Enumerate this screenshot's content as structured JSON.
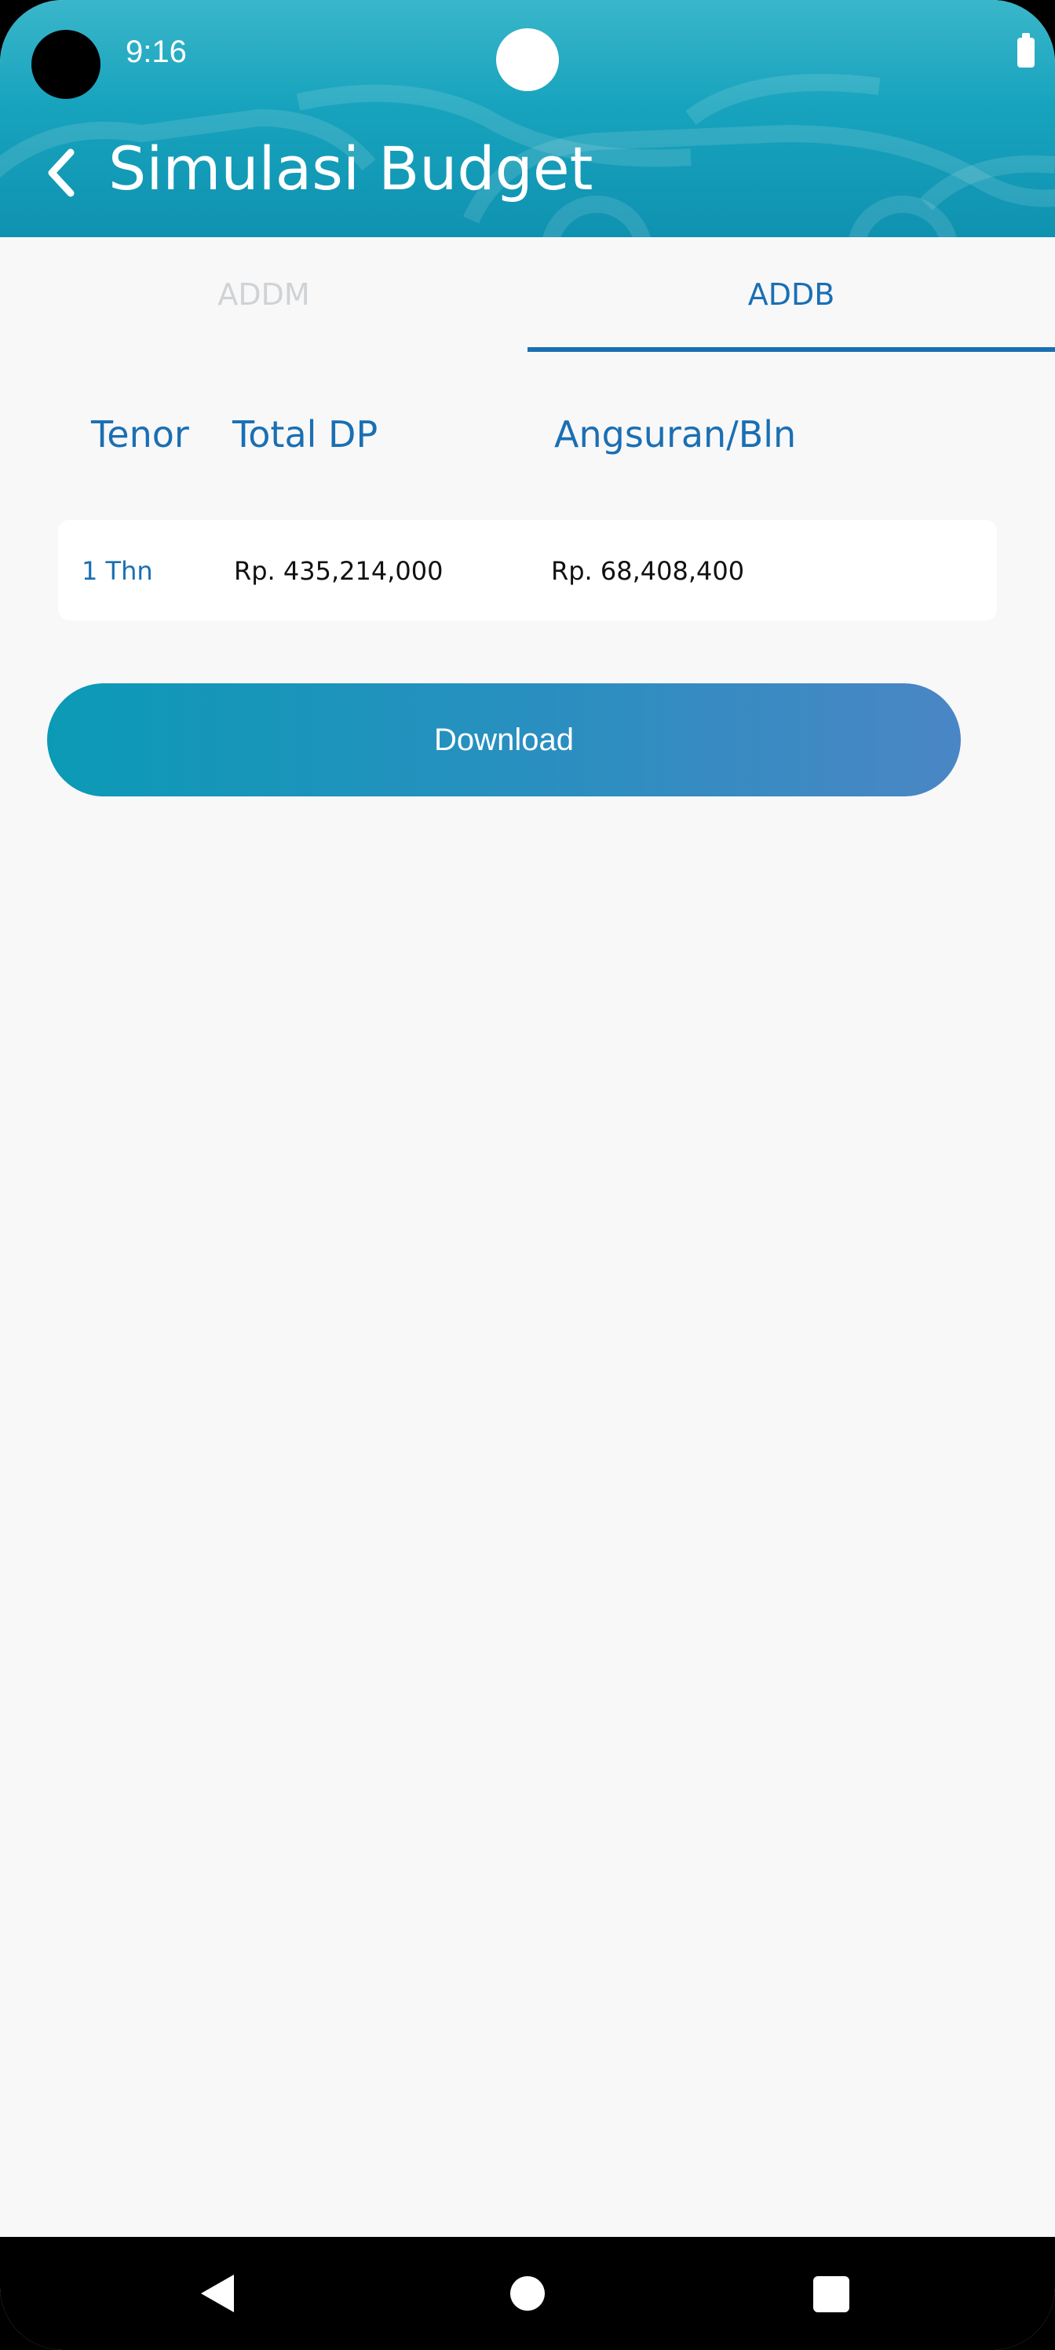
{
  "status_bar": {
    "time": "9:16"
  },
  "header": {
    "title": "Simulasi Budget",
    "back_icon": "chevron-left-icon"
  },
  "tabs": [
    {
      "label": "ADDM",
      "active": false
    },
    {
      "label": "ADDB",
      "active": true
    }
  ],
  "table": {
    "columns": [
      "Tenor",
      "Total DP",
      "Angsuran/Bln"
    ],
    "rows": [
      {
        "tenor": "1 Thn",
        "total_dp": "Rp. 435,214,000",
        "angsuran": "Rp. 68,408,400"
      }
    ]
  },
  "actions": {
    "download_label": "Download"
  },
  "colors": {
    "header": "#17a3bd",
    "accent": "#1a6fb3",
    "button_start": "#0b9ab6",
    "button_end": "#4a86c5",
    "background": "#f8f8f9"
  },
  "nav": {
    "back_icon": "nav-back-icon",
    "home_icon": "nav-home-icon",
    "recents_icon": "nav-recents-icon"
  }
}
